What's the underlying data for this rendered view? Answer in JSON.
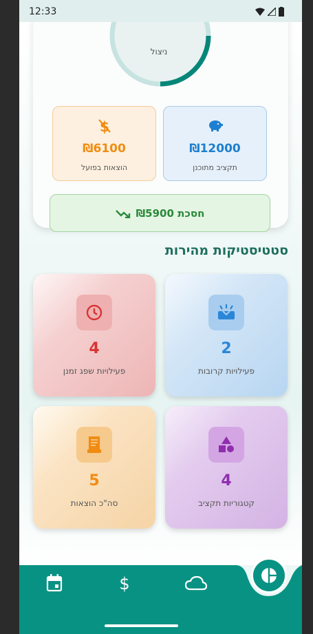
{
  "status_bar": {
    "time": "12:33"
  },
  "budget": {
    "gauge_label": "ניצול",
    "actual_expenses": {
      "value": "₪6100",
      "label": "הוצאות בפועל",
      "icon": "money-off-icon"
    },
    "planned_budget": {
      "value": "₪12000",
      "label": "תקציב מתוכנן",
      "icon": "piggy-bank-icon"
    },
    "savings": {
      "text": "חסכת ₪5900",
      "icon": "trending-up-icon"
    },
    "gauge_fill_fraction": 0.5
  },
  "quick_stats": {
    "title": "סטטיסטיקות מהירות",
    "cards": [
      {
        "key": "upcoming",
        "value": "2",
        "label": "פעילויות קרובות",
        "icon": "upcoming-icon",
        "color": "#2a87d8"
      },
      {
        "key": "peak",
        "value": "4",
        "label": "פעילויות שפג זמנן",
        "icon": "clock-icon",
        "color": "#d93333"
      },
      {
        "key": "categories",
        "value": "4",
        "label": "קטגוריות תקציב",
        "icon": "category-shapes-icon",
        "color": "#8e2fae"
      },
      {
        "key": "expenses",
        "value": "5",
        "label": "סה\"כ הוצאות",
        "icon": "receipt-icon",
        "color": "#f08c12"
      }
    ]
  },
  "nav": {
    "items": [
      {
        "icon": "calendar-icon"
      },
      {
        "icon": "dollar-icon"
      },
      {
        "icon": "cloud-icon"
      },
      {
        "icon": "pie-chart-icon",
        "active": true
      }
    ]
  },
  "colors": {
    "primary": "#089283",
    "accent_teal": "#1d6e5d"
  }
}
